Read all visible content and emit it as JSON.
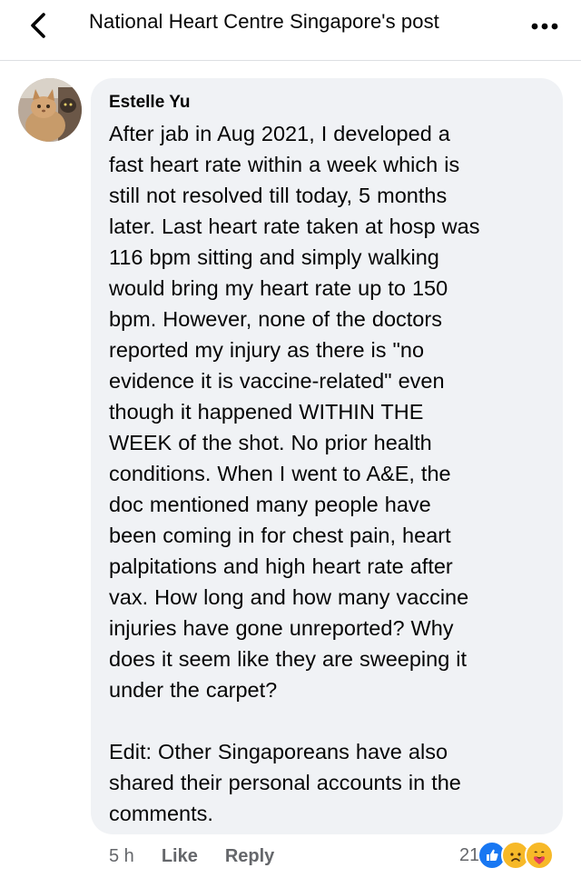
{
  "header": {
    "title": "National Heart Centre Singapore's post",
    "back_icon": "chevron-left-icon",
    "more_icon": "more-horizontal-icon"
  },
  "comment": {
    "author": "Estelle Yu",
    "text": "After jab in Aug 2021, I developed a\nfast heart rate within a week which is\nstill not resolved till today, 5 months\nlater. Last heart rate taken at hosp was\n116 bpm sitting and simply walking\nwould bring my heart rate up to 150\nbpm. However, none of the doctors\nreported my injury as there is \"no\nevidence it is vaccine-related\" even\nthough it happened WITHIN THE\nWEEK of the shot. No prior health\nconditions. When I went to A&E, the\ndoc mentioned many people have\nbeen coming in for chest pain, heart\npalpitations and high heart rate after\nvax. How long and how many vaccine\ninjuries have gone unreported? Why\ndoes it seem like they are sweeping it\nunder the carpet?\n\nEdit: Other Singaporeans have also\nshared their personal accounts in the\ncomments.",
    "time": "5 h",
    "like_label": "Like",
    "reply_label": "Reply",
    "reaction_count": "21",
    "reactions": [
      "like-reaction-icon",
      "sad-reaction-icon",
      "care-reaction-icon"
    ]
  },
  "colors": {
    "bubble": "#f0f2f5",
    "secondary_text": "#65676b",
    "like_blue": "#1877f2",
    "emoji_yellow": "#f7b928"
  }
}
